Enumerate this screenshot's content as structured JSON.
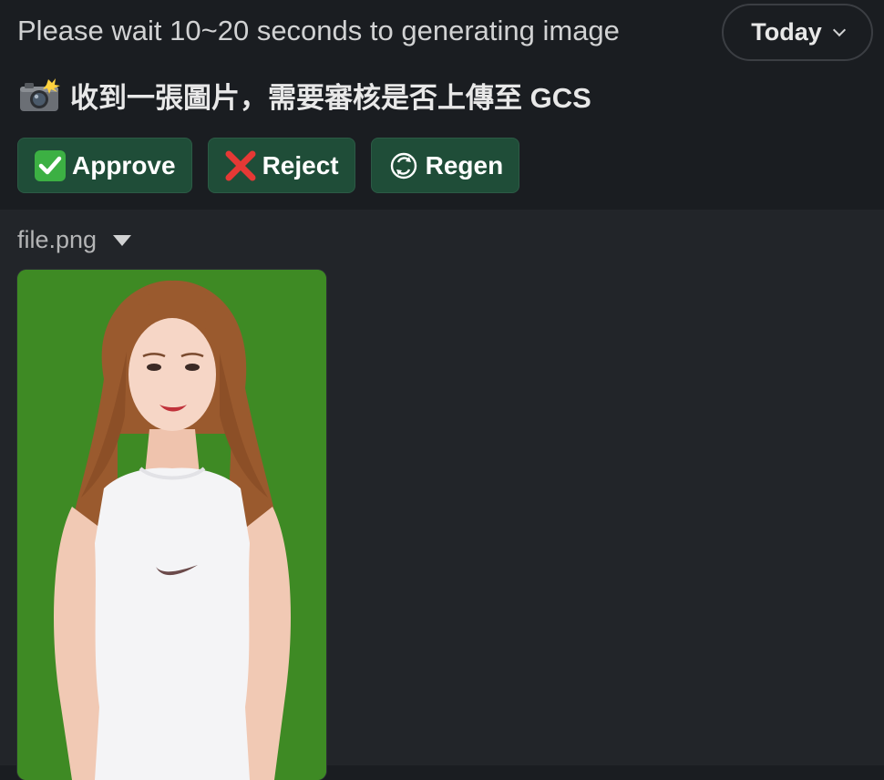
{
  "message": {
    "status_text": "Please wait 10~20 seconds to generating image",
    "date_label": "Today",
    "headline": "收到一張圖片，需要審核是否上傳至 GCS",
    "headline_icon": "camera-flash-icon"
  },
  "actions": [
    {
      "label": "Approve",
      "icon": "check-mark-icon",
      "color": "#1f4d38"
    },
    {
      "label": "Reject",
      "icon": "cross-mark-icon",
      "color": "#1f4d38"
    },
    {
      "label": "Regen",
      "icon": "refresh-icon",
      "color": "#1f4d38"
    }
  ],
  "attachment": {
    "filename": "file.png",
    "toggle_icon": "collapse-triangle-icon",
    "background_color": "#3e8a24"
  },
  "colors": {
    "app_background": "#1a1d21",
    "file_area_background": "#222529",
    "button_background": "#1f4d38"
  }
}
